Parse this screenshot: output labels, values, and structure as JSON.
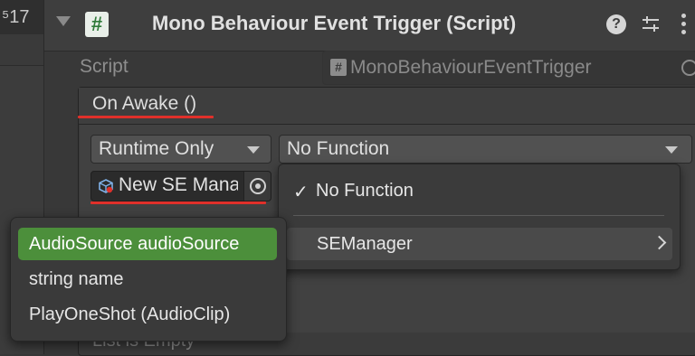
{
  "left_panel": {
    "badge": "⁵17"
  },
  "component": {
    "title": "Mono Behaviour Event Trigger (Script)",
    "script_label": "Script",
    "script_value": "MonoBehaviourEventTrigger",
    "script_icon": "#"
  },
  "event": {
    "title": "On Awake ()",
    "runtime_mode": "Runtime Only",
    "function": "No Function",
    "target_object": "New SE Manager",
    "empty_text": "List is Empty"
  },
  "function_menu": {
    "items": [
      {
        "label": "No Function",
        "checked": true,
        "check_glyph": "✓"
      },
      {
        "label": "SEManager",
        "submenu": true
      }
    ]
  },
  "member_menu": {
    "items": [
      {
        "label": "AudioSource audioSource",
        "highlighted": true
      },
      {
        "label": "string name"
      },
      {
        "label": "PlayOneShot (AudioClip)"
      }
    ]
  },
  "colors": {
    "highlight": "#4c8f3b",
    "underline": "#e0302a",
    "script_icon_green": "#2f7a39"
  }
}
